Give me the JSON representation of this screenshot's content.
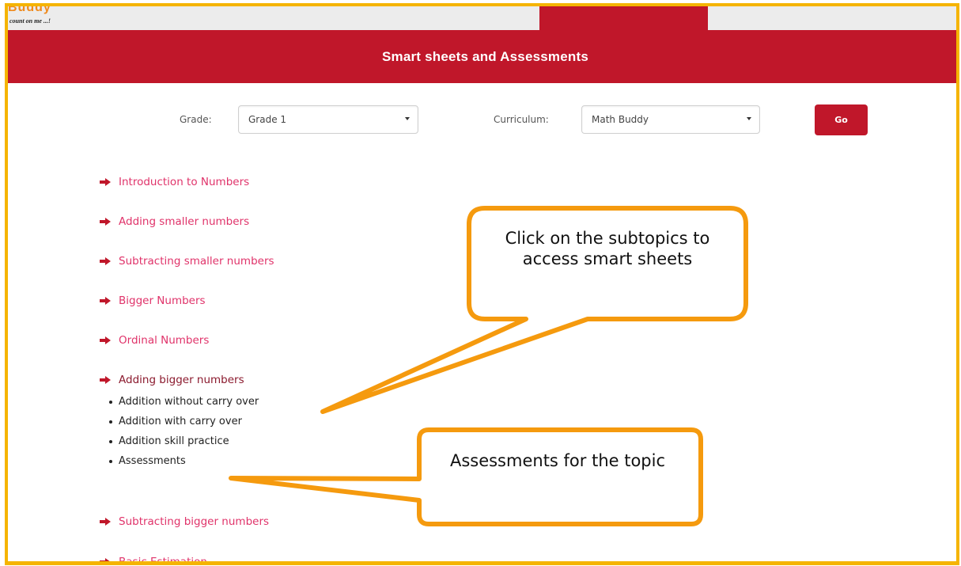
{
  "logo": {
    "brand": "Buddy",
    "tagline": "count on me ...!"
  },
  "header": {
    "title": "Smart sheets and Assessments"
  },
  "filters": {
    "grade_label": "Grade:",
    "grade_value": "Grade 1",
    "curriculum_label": "Curriculum:",
    "curriculum_value": "Math Buddy",
    "go_label": "Go"
  },
  "topics": [
    {
      "label": "Introduction to Numbers"
    },
    {
      "label": "Adding smaller numbers"
    },
    {
      "label": "Subtracting smaller numbers"
    },
    {
      "label": "Bigger Numbers"
    },
    {
      "label": "Ordinal Numbers"
    },
    {
      "label": "Adding bigger numbers"
    },
    {
      "label": "Subtracting bigger numbers"
    },
    {
      "label": "Basic Estimation"
    }
  ],
  "subtopics": [
    {
      "label": "Addition without carry over"
    },
    {
      "label": "Addition with carry over"
    },
    {
      "label": "Addition skill practice"
    },
    {
      "label": "Assessments"
    }
  ],
  "callouts": {
    "subtopics_note": "Click on the subtopics to access smart sheets",
    "assessments_note": "Assessments for the topic"
  },
  "colors": {
    "brand_red": "#c0172a",
    "topic_link": "#e0336a",
    "callout_border": "#f59a0e",
    "frame_border": "#f5b400"
  },
  "icons": {
    "topic_bullet": "arrow-right-icon",
    "subtopic_bullet": "bullet-dot-icon"
  }
}
